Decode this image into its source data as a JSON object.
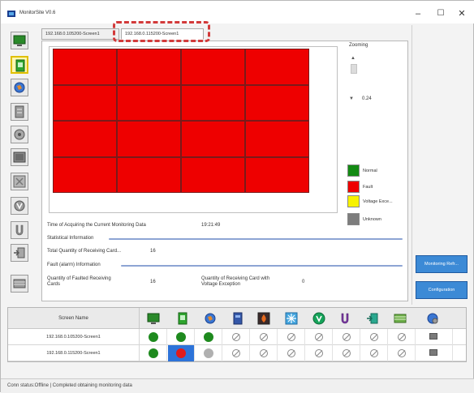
{
  "window": {
    "title": "MonitorSite V0.6"
  },
  "tabs": [
    {
      "label": "192.168.0.105200-Screen1"
    },
    {
      "label": "192.168.0.115200-Screen1"
    }
  ],
  "display": {
    "rows": 4,
    "cols": 4,
    "cell_color": "#ee0000"
  },
  "zoom": {
    "label": "Zooming",
    "value": "0.24"
  },
  "legend": [
    {
      "label": "Normal",
      "color": "#138a13"
    },
    {
      "label": "Fault",
      "color": "#ee0000"
    },
    {
      "label": "Voltage Exce...",
      "color": "#f7f200"
    },
    {
      "label": "Unknown",
      "color": "#7d7d7d"
    }
  ],
  "info": {
    "time_label": "Time of Acquiring the Current Monitoring Data",
    "time_value": "19:21:49",
    "stat_section": "Statistical Information",
    "total_label": "Total Quantity of Receiving Card...",
    "total_value": "16",
    "fault_section": "Fault (alarm) Information",
    "faulted_label_1": "Quantity of Faulted Receiving",
    "faulted_label_2": "Cards",
    "faulted_value": "16",
    "voltage_label_1": "Quantity of Receiving Card with",
    "voltage_label_2": "Voltage Exception",
    "voltage_value": "0"
  },
  "right_buttons": {
    "monitoring": "Monitoring Refr...",
    "configuration": "Configuration"
  },
  "table": {
    "header": "Screen Name",
    "rows": [
      {
        "name": "192.168.0.105200-Screen1"
      },
      {
        "name": "192.168.0.115200-Screen1"
      }
    ]
  },
  "status": "Conn status:Offline  |  Completed obtaining monitoring data"
}
